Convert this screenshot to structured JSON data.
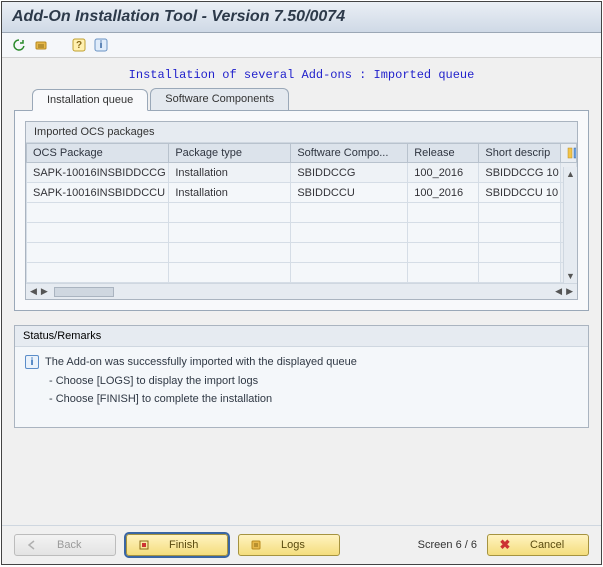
{
  "title": "Add-On Installation Tool - Version 7.50/0074",
  "subtitle": "Installation of several Add-ons : Imported queue",
  "tabs": [
    {
      "label": "Installation queue",
      "active": true
    },
    {
      "label": "Software Components",
      "active": false
    }
  ],
  "packages_group_title": "Imported OCS packages",
  "grid": {
    "columns": [
      "OCS Package",
      "Package type",
      "Software Compo...",
      "Release",
      "Short descrip"
    ],
    "rows": [
      {
        "c0": "SAPK-10016INSBIDDCCG",
        "c1": "Installation",
        "c2": "SBIDDCCG",
        "c3": "100_2016",
        "c4": "SBIDDCCG 10"
      },
      {
        "c0": "SAPK-10016INSBIDDCCU",
        "c1": "Installation",
        "c2": "SBIDDCCU",
        "c3": "100_2016",
        "c4": "SBIDDCCU 10"
      }
    ]
  },
  "status": {
    "title": "Status/Remarks",
    "line1": "The Add-on was successfully imported with the displayed queue",
    "line2": "- Choose [LOGS] to display the import logs",
    "line3": "- Choose [FINISH] to complete the installation"
  },
  "footer": {
    "back": "Back",
    "finish": "Finish",
    "logs": "Logs",
    "screen": "Screen 6 / 6",
    "cancel": "Cancel"
  }
}
